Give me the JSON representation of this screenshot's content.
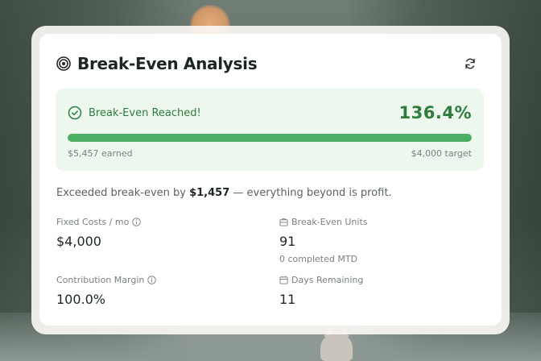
{
  "header": {
    "title": "Break-Even Analysis",
    "title_icon": "target-icon",
    "refresh_icon": "refresh-icon"
  },
  "status": {
    "label": "Break-Even Reached!",
    "percent": "136.4%",
    "progress_fraction": 1.0,
    "earned_label": "$5,457 earned",
    "target_label": "$4,000 target",
    "check_icon": "check-circle-icon"
  },
  "summary": {
    "prefix": "Exceeded break-even by ",
    "amount": "$1,457",
    "suffix": " — everything beyond is profit."
  },
  "stats": {
    "fixed_costs": {
      "label": "Fixed Costs / mo",
      "value": "$4,000",
      "info_icon": "info-icon"
    },
    "break_even_units": {
      "label": "Break-Even Units",
      "value": "91",
      "sub": "0 completed MTD",
      "icon": "box-icon"
    },
    "contribution_margin": {
      "label": "Contribution Margin",
      "value": "100.0%",
      "info_icon": "info-icon"
    },
    "days_remaining": {
      "label": "Days Remaining",
      "value": "11",
      "icon": "calendar-icon"
    }
  },
  "colors": {
    "accent_green": "#2e7d3f",
    "progress_fill": "#4caf63",
    "status_bg": "#eef7ee"
  }
}
